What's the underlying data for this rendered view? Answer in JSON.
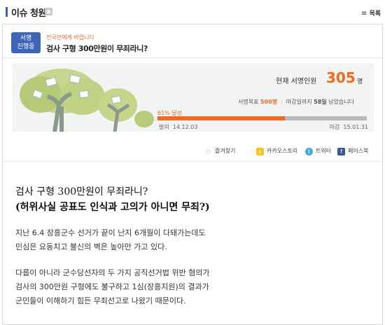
{
  "section": {
    "title": "이슈 청원",
    "list_label": "목록"
  },
  "petition": {
    "badge_line1": "서명",
    "badge_line2": "진행중",
    "kicker": "전국민에게 바랍니다",
    "title": "검사 구형 300만원이 무죄라니?"
  },
  "stats": {
    "signers_label": "현재 서명인원",
    "signers_count": "305",
    "signers_unit": "명",
    "goal_label": "서명목표",
    "goal_value": "500명",
    "deadline_label": "마감일까지",
    "deadline_days": "58일",
    "deadline_suffix": "남았습니다",
    "percent_text": "61% 달성",
    "progress": 0.61,
    "start_label": "발의",
    "start_date": "14.12.03",
    "end_label": "마감",
    "end_date": "15.01.31"
  },
  "actions": {
    "favorite": "즐겨찾기",
    "kakao": "카카오스토리",
    "twitter": "트위터",
    "facebook": "페이스북"
  },
  "body": {
    "headline1": "검사 구형 300만원이 무죄라니?",
    "headline2": "(허위사실 공표도 인식과 고의가 아니면 무죄?)",
    "p1_line1": "지난 6.4 장흥군수 선거가 끝이 난지 6개월이 다돼가는데도",
    "p1_line2": "민심은 요동치고 불신의 벽은 높아만 가고 있다.",
    "p2_line1": "다름이 아니라 군수당선자의 두 가지 공직선거법 위반 혐의가",
    "p2_line2": "검사의 300만원 구형에도 불구하고 1심(장흥지원)의 결과가",
    "p2_line3": "군민들이 이해하기 힘든 무죄선고로 나왔기 때문이다."
  },
  "colors": {
    "accent": "#f06b21",
    "badge": "#3f65b9",
    "bar_bg": "#b9b9b9"
  },
  "icons": {
    "rss": "rss-icon",
    "list": "list-icon",
    "star": "star-icon",
    "kakao": "kakaostory-icon",
    "twitter": "twitter-icon",
    "facebook": "facebook-icon"
  }
}
